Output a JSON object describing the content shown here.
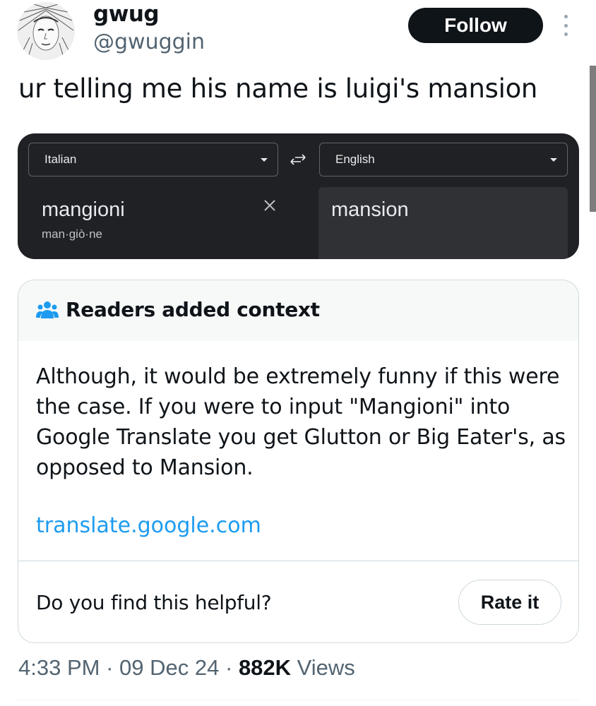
{
  "author": {
    "display_name": "gwug",
    "handle": "@gwuggin",
    "follow_label": "Follow"
  },
  "tweet": {
    "text": "ur telling me his name is luigi's mansion"
  },
  "translate": {
    "source_language": "Italian",
    "target_language": "English",
    "source_text": "mangioni",
    "source_phonetic": "man·giò·ne",
    "target_text": "mansion"
  },
  "community_note": {
    "title": "Readers added context",
    "body": "Although, it would be extremely funny if this were the case. If you were to input \"Mangioni\" into Google Translate you get Glutton or Big Eater's, as opposed to Mansion.",
    "link": "translate.google.com",
    "helpful_question": "Do you find this helpful?",
    "rate_label": "Rate it"
  },
  "meta": {
    "time": "4:33 PM",
    "separator": "·",
    "date": "09 Dec 24",
    "views_count": "882K",
    "views_label": "Views"
  },
  "colors": {
    "accent": "#1d9bf0",
    "text_primary": "#0f1419",
    "text_secondary": "#536471",
    "translate_bg": "#202124"
  },
  "icons": {
    "avatar": "avatar-sketch-face",
    "more": "more-vertical-icon",
    "swap": "swap-arrows-icon",
    "clear": "close-icon",
    "people": "people-icon"
  }
}
